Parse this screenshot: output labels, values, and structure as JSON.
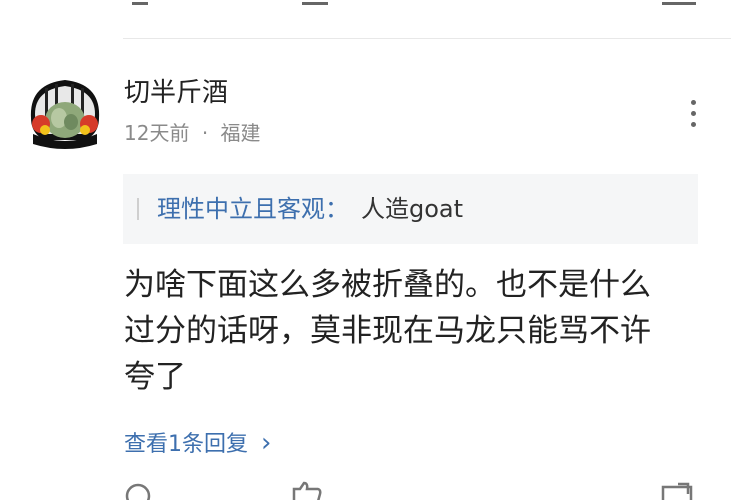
{
  "comment": {
    "username": "切半斤酒",
    "time": "12天前",
    "separator": "·",
    "location": "福建",
    "quote": {
      "author": "理性中立且客观：",
      "text": "人造goat"
    },
    "content_lines": [
      "为啥下面这么多被折叠的。也不是什么",
      "过分的话呀，莫非现在马龙只能骂不许",
      "夸了"
    ],
    "reply_link": "查看1条回复",
    "reply_link_chevron": "›"
  },
  "icons": {
    "avatar": "avatar-image",
    "more": "more-vertical-icon",
    "reply": "reply-icon",
    "like": "like-icon",
    "share": "share-icon"
  },
  "colors": {
    "link_blue": "#3d6fae",
    "meta_gray": "#8a8a8a",
    "quote_bg": "#f5f6f7",
    "text": "#222222"
  }
}
